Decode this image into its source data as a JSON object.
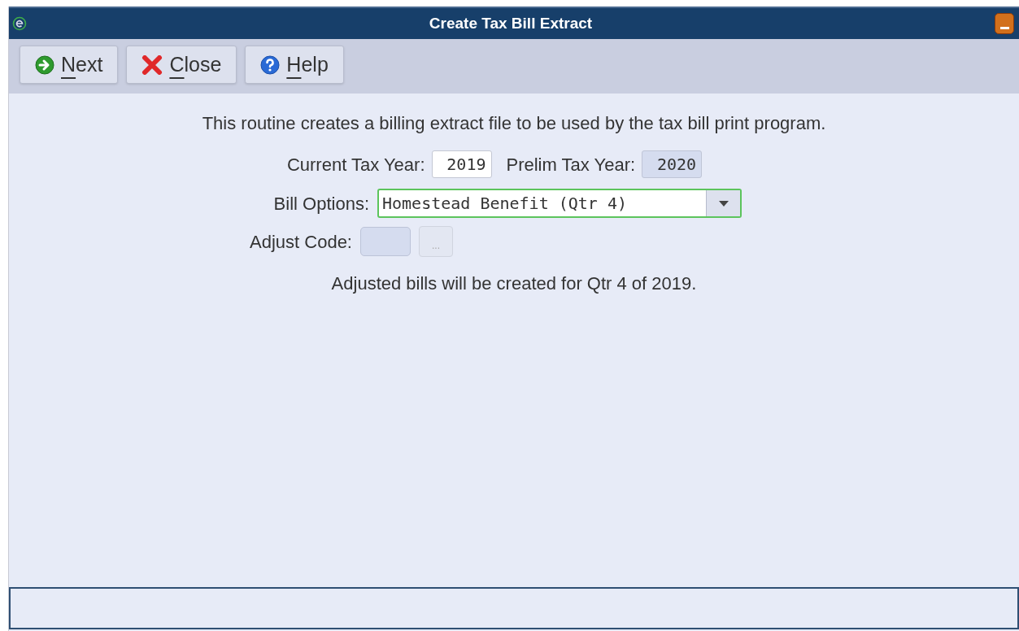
{
  "window": {
    "title": "Create Tax Bill Extract"
  },
  "toolbar": [
    {
      "kind": "next",
      "label": "Next"
    },
    {
      "kind": "close",
      "label": "Close"
    },
    {
      "kind": "help",
      "label": "Help"
    }
  ],
  "intro": "This routine creates a billing extract file to be used by the tax bill print program.",
  "current_tax_year": {
    "label": "Current Tax Year:",
    "value": "2019",
    "disabled": false
  },
  "prelim_tax_year": {
    "label": "Prelim Tax Year:",
    "value": "2020",
    "disabled": true
  },
  "bill_options": {
    "label": "Bill Options:",
    "value": "Homestead Benefit (Qtr 4)",
    "focused": true
  },
  "adjust_code": {
    "label": "Adjust Code:",
    "disabled": true,
    "lookup": "..."
  },
  "message": "Adjusted bills will be created for Qtr 4 of 2019."
}
